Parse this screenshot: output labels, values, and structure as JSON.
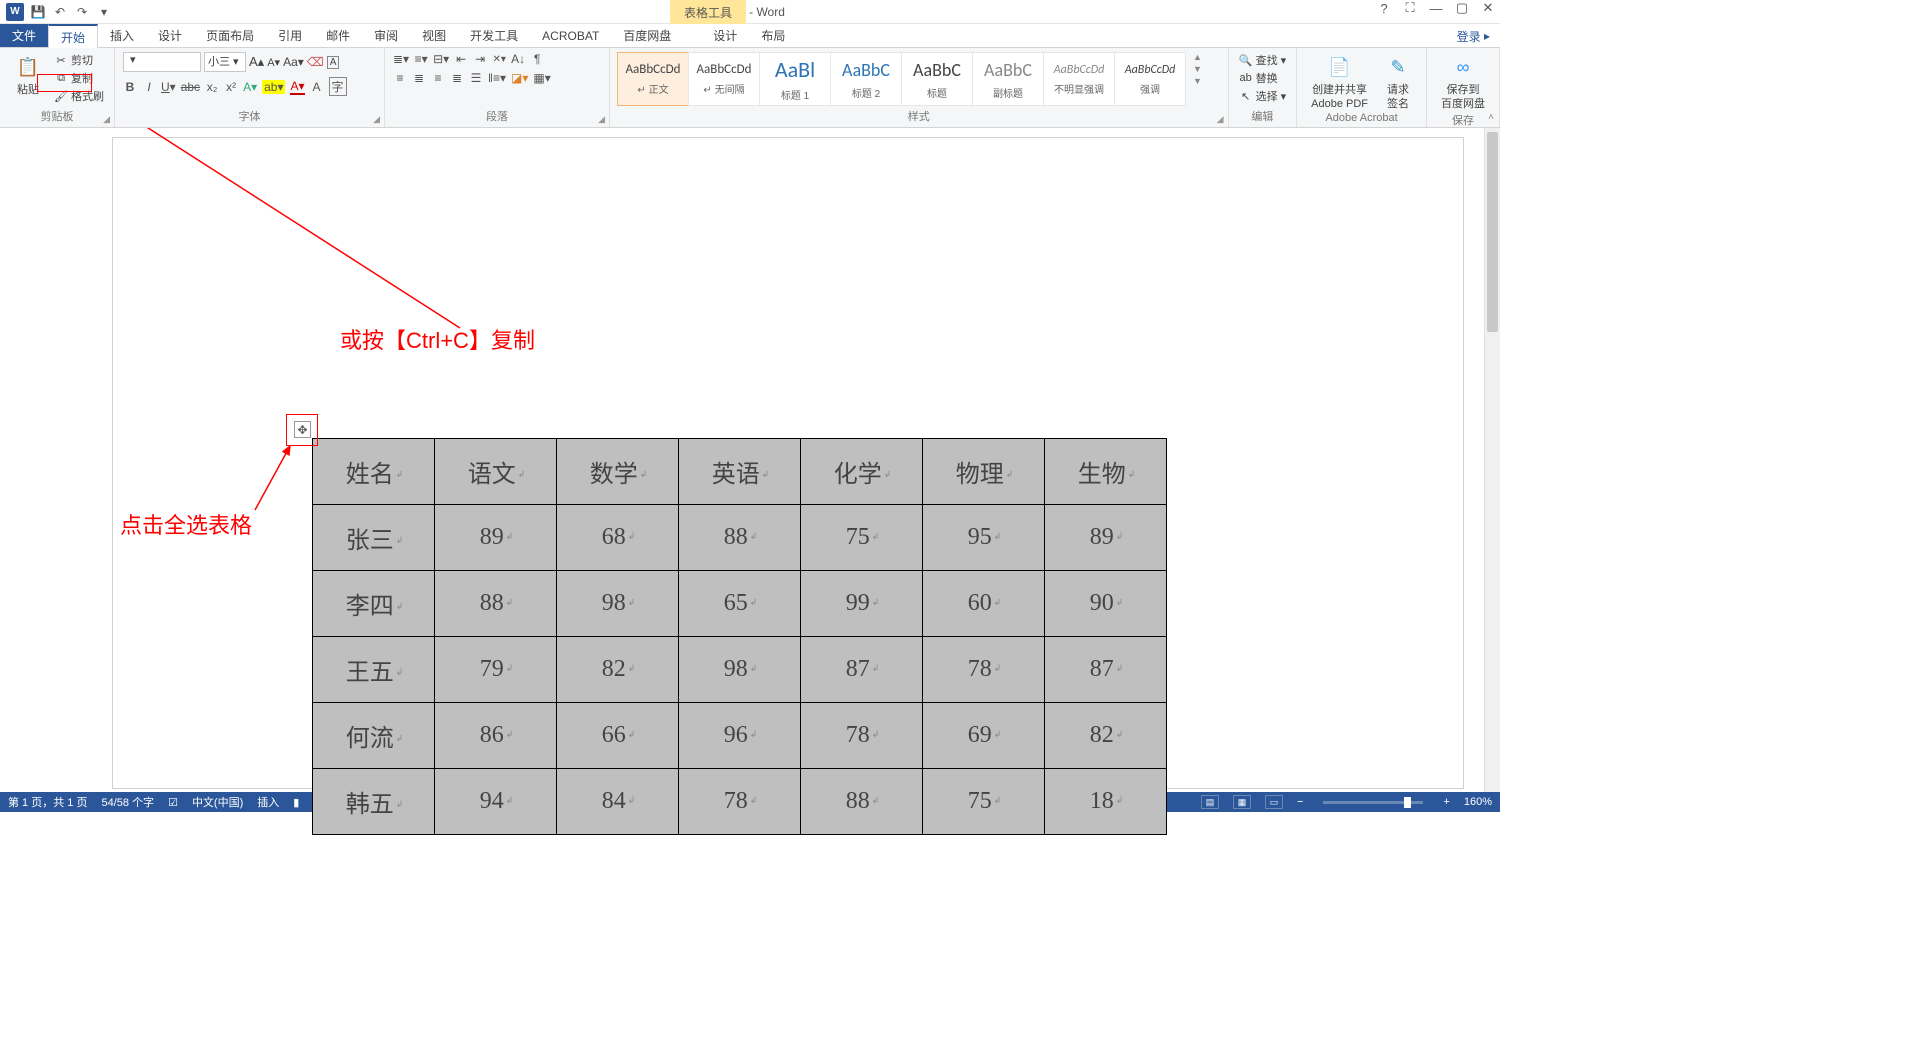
{
  "titlebar": {
    "app_icon_letter": "W",
    "doc_title": "文档1 - Word",
    "tools_context": "表格工具",
    "help": "?",
    "login": "登录"
  },
  "tabs": {
    "file": "文件",
    "home": "开始",
    "insert": "插入",
    "design": "设计",
    "layout": "页面布局",
    "ref": "引用",
    "mail": "邮件",
    "review": "审阅",
    "view": "视图",
    "dev": "开发工具",
    "acrobat": "ACROBAT",
    "baidu": "百度网盘",
    "tdesign": "设计",
    "tlayout": "布局"
  },
  "clipboard": {
    "paste": "粘贴",
    "cut": "剪切",
    "copy": "复制",
    "painter": "格式刷",
    "group": "剪贴板"
  },
  "font": {
    "size": "小三",
    "group": "字体"
  },
  "para": {
    "group": "段落"
  },
  "styles": {
    "group": "样式",
    "items": [
      {
        "prev": "AaBbCcDd",
        "name": "↵ 正文",
        "sel": true,
        "fs": "13px"
      },
      {
        "prev": "AaBbCcDd",
        "name": "↵ 无间隔",
        "fs": "13px"
      },
      {
        "prev": "AaBl",
        "name": "标题 1",
        "fs": "22px",
        "color": "#2e74b5"
      },
      {
        "prev": "AaBbC",
        "name": "标题 2",
        "fs": "18px",
        "color": "#2e74b5"
      },
      {
        "prev": "AaBbC",
        "name": "标题",
        "fs": "18px"
      },
      {
        "prev": "AaBbC",
        "name": "副标题",
        "fs": "18px",
        "color": "#888"
      },
      {
        "prev": "AaBbCcDd",
        "name": "不明显强调",
        "fs": "12px",
        "italic": true,
        "color": "#888"
      },
      {
        "prev": "AaBbCcDd",
        "name": "强调",
        "fs": "12px",
        "italic": true
      }
    ]
  },
  "editing": {
    "find": "查找",
    "replace": "替换",
    "select": "选择",
    "group": "编辑"
  },
  "acrobat_grp": {
    "create": "创建并共享",
    "create2": "Adobe PDF",
    "sign": "请求",
    "sign2": "签名",
    "group": "Adobe Acrobat"
  },
  "baidu_grp": {
    "save": "保存到",
    "save2": "百度网盘",
    "group": "保存"
  },
  "annotations": {
    "copy_hint": "或按【Ctrl+C】复制",
    "select_hint": "点击全选表格"
  },
  "table": {
    "headers": [
      "姓名",
      "语文",
      "数学",
      "英语",
      "化学",
      "物理",
      "生物"
    ],
    "rows": [
      [
        "张三",
        "89",
        "68",
        "88",
        "75",
        "95",
        "89"
      ],
      [
        "李四",
        "88",
        "98",
        "65",
        "99",
        "60",
        "90"
      ],
      [
        "王五",
        "79",
        "82",
        "98",
        "87",
        "78",
        "87"
      ],
      [
        "何流",
        "86",
        "66",
        "96",
        "78",
        "69",
        "82"
      ],
      [
        "韩五",
        "94",
        "84",
        "78",
        "88",
        "75",
        "18"
      ]
    ]
  },
  "status": {
    "page": "第 1 页，共 1 页",
    "words": "54/58 个字",
    "lang": "中文(中国)",
    "mode": "插入",
    "zoom": "160%"
  }
}
